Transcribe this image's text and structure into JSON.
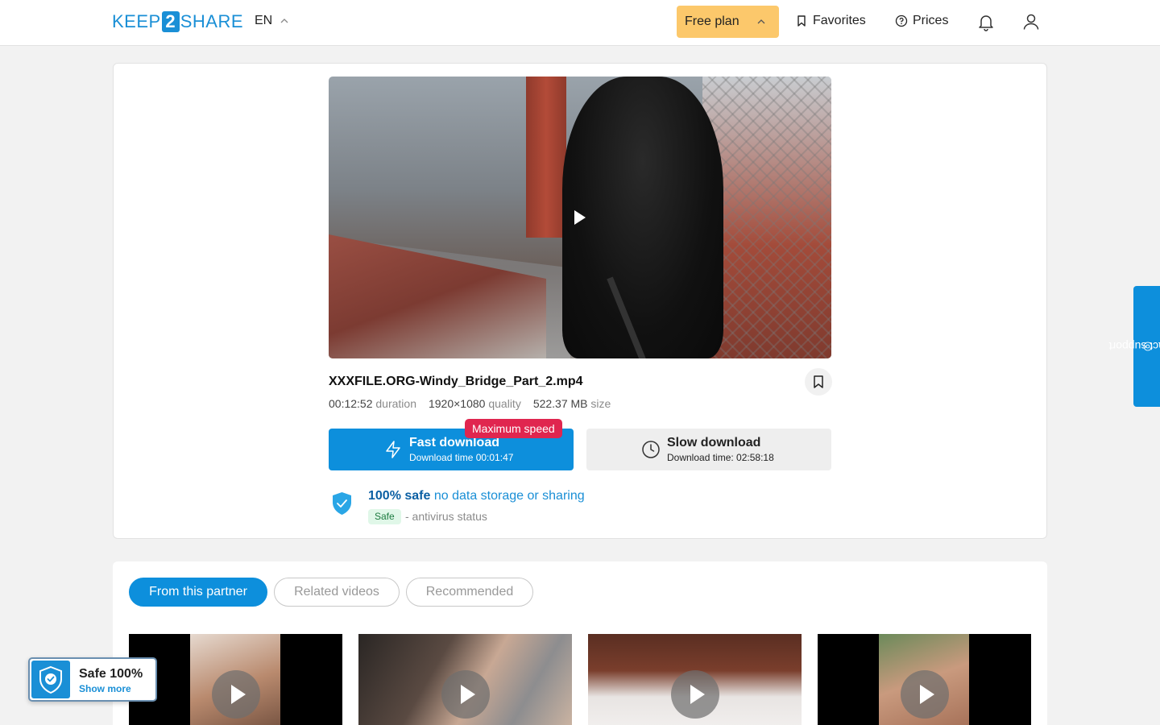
{
  "header": {
    "logo_left": "KEEP",
    "logo_num": "2",
    "logo_right": "SHARE",
    "language": "EN",
    "plan_label": "Free plan",
    "favorites_label": "Favorites",
    "prices_label": "Prices"
  },
  "file": {
    "name": "XXXFILE.ORG-Windy_Bridge_Part_2.mp4",
    "duration_value": "00:12:52",
    "duration_label": "duration",
    "quality_value": "1920×1080",
    "quality_label": "quality",
    "size_value": "522.37 MB",
    "size_label": "size"
  },
  "download": {
    "fast_label": "Fast download",
    "fast_time": "Download time 00:01:47",
    "max_badge": "Maximum speed",
    "slow_label": "Slow download",
    "slow_time": "Download time: 02:58:18"
  },
  "safety": {
    "bold": "100% safe",
    "rest": "no data storage or sharing",
    "tag": "Safe",
    "status": "- antivirus status"
  },
  "tabs": [
    {
      "label": "From this partner",
      "active": true
    },
    {
      "label": "Related videos",
      "active": false
    },
    {
      "label": "Recommended",
      "active": false
    }
  ],
  "support_label": "contact support",
  "widget": {
    "title": "Safe 100%",
    "link": "Show more"
  },
  "colors": {
    "brand": "#1a8fd6",
    "plan_bg": "#fcc86b",
    "max_badge": "#e0264f"
  }
}
